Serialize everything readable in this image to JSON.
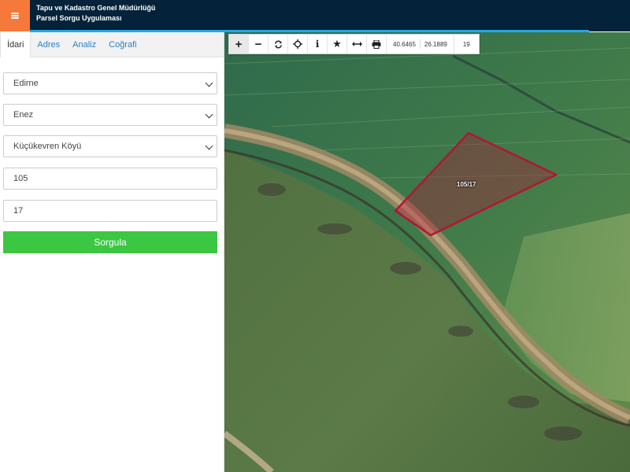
{
  "header": {
    "title_line1": "Tapu ve Kadastro Genel Müdürlüğü",
    "title_line2": "Parsel Sorgu Uygulaması"
  },
  "sidebar": {
    "tabs": [
      {
        "label": "İdari",
        "active": true
      },
      {
        "label": "Adres",
        "active": false
      },
      {
        "label": "Analiz",
        "active": false
      },
      {
        "label": "Coğrafi",
        "active": false
      }
    ],
    "form": {
      "il": "Edirne",
      "ilce": "Enez",
      "mahalle": "Küçükevren Köyü",
      "ada": "105",
      "parsel": "17",
      "query_label": "Sorgula"
    }
  },
  "toolbar": {
    "tools": [
      "plus-icon",
      "minus-icon",
      "refresh-icon",
      "locate-icon",
      "info-icon",
      "star-icon",
      "measure-icon",
      "print-icon"
    ],
    "lat": "40.6465",
    "lon": "26.1889",
    "zoom": "19"
  },
  "map": {
    "parcel_label": "105/17",
    "parcel_color": "#b01636"
  },
  "colors": {
    "header_bg": "#04223a",
    "menu_accent": "#f4793a",
    "progress": "#23a6e6",
    "tab_link": "#2a7fc6",
    "query_button": "#3bc742"
  }
}
